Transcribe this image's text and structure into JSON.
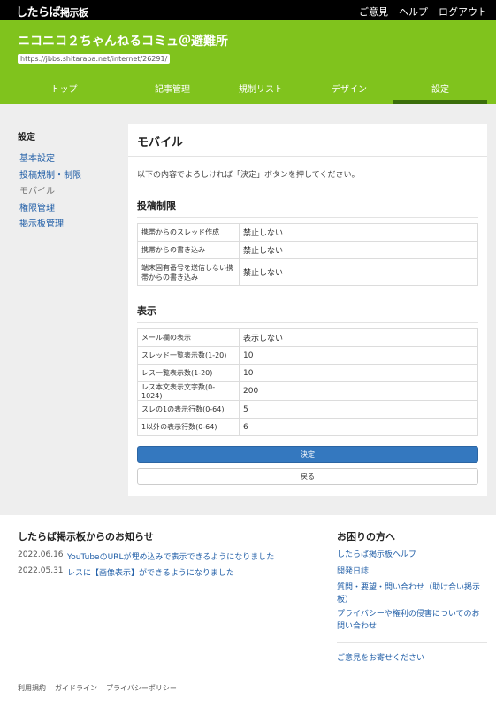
{
  "topbar": {
    "logo_main": "したらば",
    "logo_sub": "掲示板",
    "links": [
      "ご意見",
      "ヘルプ",
      "ログアウト"
    ]
  },
  "header": {
    "title": "ニコニコ２ちゃんねるコミュ＠避難所",
    "url": "https://jbbs.shitaraba.net/internet/26291/",
    "tabs": [
      "トップ",
      "記事管理",
      "規制リスト",
      "デザイン",
      "設定"
    ],
    "active_tab": "設定"
  },
  "sidebar": {
    "title": "設定",
    "items": [
      "基本設定",
      "投稿規制・制限",
      "モバイル",
      "権限管理",
      "掲示板管理"
    ],
    "current": "モバイル"
  },
  "main": {
    "title": "モバイル",
    "intro": "以下の内容でよろしければ「決定」ボタンを押してください。",
    "sections": [
      {
        "title": "投稿制限",
        "rows": [
          {
            "key": "携帯からのスレッド作成",
            "value": "禁止しない"
          },
          {
            "key": "携帯からの書き込み",
            "value": "禁止しない"
          },
          {
            "key": "端末固有番号を送信しない携帯からの書き込み",
            "value": "禁止しない"
          }
        ]
      },
      {
        "title": "表示",
        "rows": [
          {
            "key": "メール欄の表示",
            "value": "表示しない"
          },
          {
            "key": "スレッド一覧表示数(1-20)",
            "value": "10"
          },
          {
            "key": "レス一覧表示数(1-20)",
            "value": "10"
          },
          {
            "key": "レス本文表示文字数(0-1024)",
            "value": "200"
          },
          {
            "key": "スレの1の表示行数(0-64)",
            "value": "5"
          },
          {
            "key": "1以外の表示行数(0-64)",
            "value": "6"
          }
        ]
      }
    ],
    "submit_label": "決定",
    "back_label": "戻る"
  },
  "footer": {
    "news_title": "したらば掲示板からのお知らせ",
    "news": [
      {
        "date": "2022.06.16",
        "text": "YouTubeのURLが埋め込みで表示できるようになりました"
      },
      {
        "date": "2022.05.31",
        "text": "レスに【画像表示】ができるようになりました"
      }
    ],
    "help_title": "お困りの方へ",
    "help_links": [
      "したらば掲示板ヘルプ",
      "開発日誌",
      "質問・要望・問い合わせ（助け合い掲示板）",
      "プライバシーや権利の侵害についてのお問い合わせ"
    ],
    "feedback_link": "ご意見をお寄せください",
    "bottom_links": [
      "利用規約",
      "ガイドライン",
      "プライバシーポリシー"
    ]
  },
  "colors": {
    "header_green": "#80c31d",
    "topbar": "#000000",
    "primary_button": "#3478bf",
    "link": "#2360a8"
  }
}
